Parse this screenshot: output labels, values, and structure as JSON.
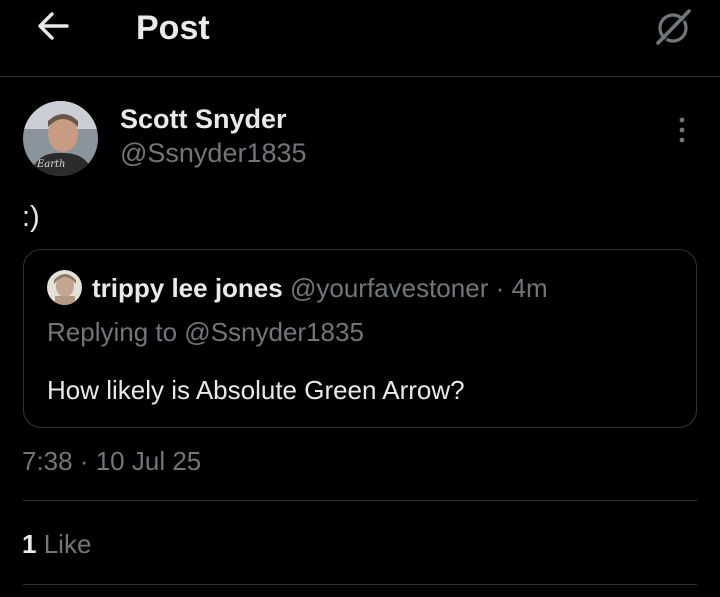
{
  "header": {
    "title": "Post",
    "back_icon": "arrow-left-icon",
    "grok_icon": "grok-icon"
  },
  "post": {
    "author_name": "Scott Snyder",
    "author_handle": "@Ssnyder1835",
    "text": ":)",
    "timestamp": "7:38 · 10 Jul 25",
    "likes_count": "1",
    "likes_label": "Like",
    "more_icon": "more-vertical-icon"
  },
  "quote": {
    "author_name": "trippy lee jones",
    "author_handle": "@yourfavestoner",
    "separator": "·",
    "age": "4m",
    "replying_to": "Replying to @Ssnyder1835",
    "text": "How likely is Absolute Green Arrow?"
  },
  "colors": {
    "background": "#000000",
    "primary_text": "#e7e9ea",
    "secondary_text": "#71767b",
    "border": "#2f3336"
  }
}
